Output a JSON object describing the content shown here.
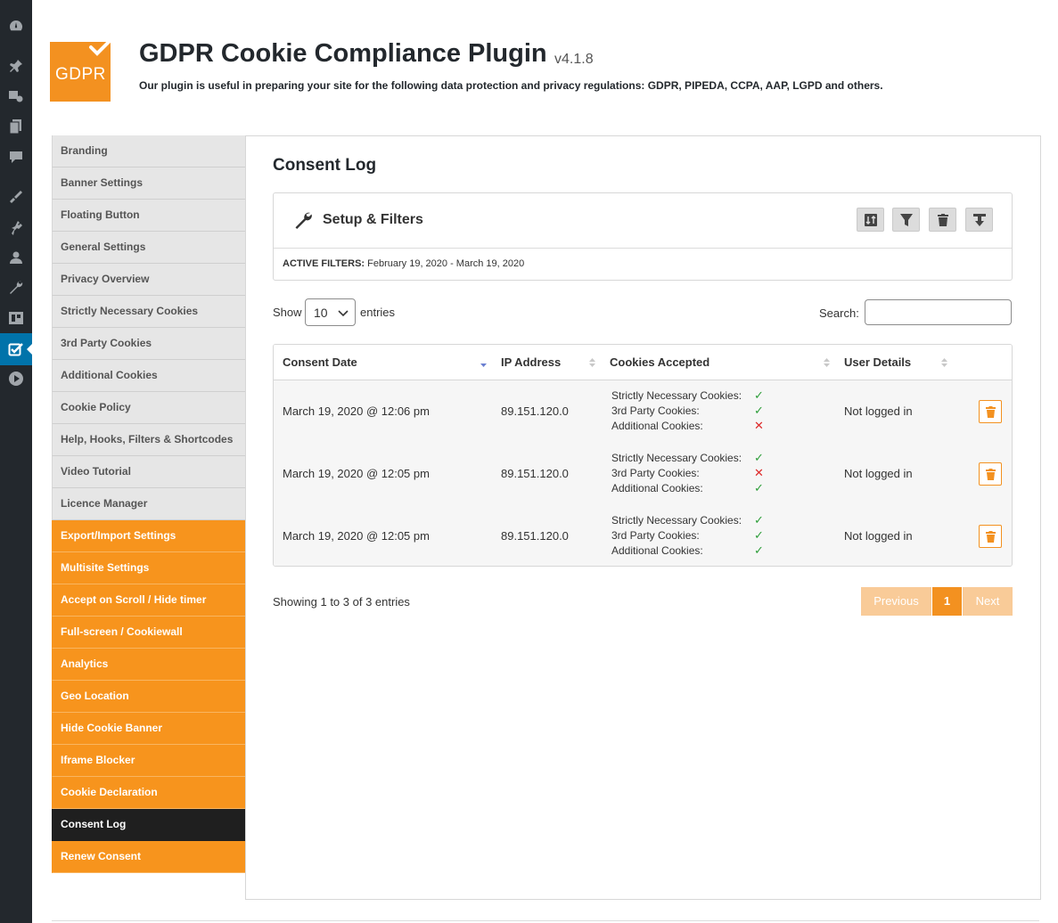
{
  "plugin": {
    "logo_text": "GDPR",
    "title": "GDPR Cookie Compliance Plugin",
    "version": "v4.1.8",
    "subtitle": "Our plugin is useful in preparing your site for the following data protection and privacy regulations: GDPR, PIPEDA, CCPA, AAP, LGPD and others."
  },
  "wp_menu": {
    "icons": [
      "dashboard-icon",
      "pin-icon",
      "media-icon",
      "pages-icon",
      "comments-icon",
      "appearance-icon",
      "plugins-icon",
      "users-icon",
      "tools-icon",
      "settings-icon",
      "gdpr-icon",
      "video-icon"
    ],
    "active_color": "#0073aa"
  },
  "nav": {
    "items": [
      {
        "label": "Branding",
        "style": "grey"
      },
      {
        "label": "Banner Settings",
        "style": "grey"
      },
      {
        "label": "Floating Button",
        "style": "grey"
      },
      {
        "label": "General Settings",
        "style": "grey"
      },
      {
        "label": "Privacy Overview",
        "style": "grey"
      },
      {
        "label": "Strictly Necessary Cookies",
        "style": "grey"
      },
      {
        "label": "3rd Party Cookies",
        "style": "grey"
      },
      {
        "label": "Additional Cookies",
        "style": "grey"
      },
      {
        "label": "Cookie Policy",
        "style": "grey"
      },
      {
        "label": "Help, Hooks, Filters & Shortcodes",
        "style": "grey"
      },
      {
        "label": "Video Tutorial",
        "style": "grey"
      },
      {
        "label": "Licence Manager",
        "style": "grey"
      },
      {
        "label": "Export/Import Settings",
        "style": "orange"
      },
      {
        "label": "Multisite Settings",
        "style": "orange"
      },
      {
        "label": "Accept on Scroll / Hide timer",
        "style": "orange"
      },
      {
        "label": "Full-screen / Cookiewall",
        "style": "orange"
      },
      {
        "label": "Analytics",
        "style": "orange"
      },
      {
        "label": "Geo Location",
        "style": "orange"
      },
      {
        "label": "Hide Cookie Banner",
        "style": "orange"
      },
      {
        "label": "Iframe Blocker",
        "style": "orange"
      },
      {
        "label": "Cookie Declaration",
        "style": "orange"
      },
      {
        "label": "Consent Log",
        "style": "active"
      },
      {
        "label": "Renew Consent",
        "style": "orange"
      }
    ]
  },
  "main": {
    "title": "Consent Log",
    "filters": {
      "title": "Setup & Filters",
      "buttons": [
        "sort-icon",
        "filter-icon",
        "trash-icon",
        "download-icon"
      ],
      "active_label": "ACTIVE FILTERS:",
      "active_value": "February 19, 2020 - March 19, 2020"
    },
    "show_label": "Show",
    "entries_value": "10",
    "entries_label": "entries",
    "search_label": "Search:",
    "search_value": "",
    "table": {
      "headers": [
        "Consent Date",
        "IP Address",
        "Cookies Accepted",
        "User Details"
      ],
      "rows": [
        {
          "date": "March 19, 2020 @ 12:06 pm",
          "ip": "89.151.120.0",
          "cookies": [
            {
              "label": "Strictly Necessary Cookies:",
              "mark": "✓",
              "ok": true
            },
            {
              "label": "3rd Party Cookies:",
              "mark": "✓",
              "ok": true
            },
            {
              "label": "Additional Cookies:",
              "mark": "✕",
              "ok": false
            }
          ],
          "user": "Not logged in"
        },
        {
          "date": "March 19, 2020 @ 12:05 pm",
          "ip": "89.151.120.0",
          "cookies": [
            {
              "label": "Strictly Necessary Cookies:",
              "mark": "✓",
              "ok": true
            },
            {
              "label": "3rd Party Cookies:",
              "mark": "✕",
              "ok": false
            },
            {
              "label": "Additional Cookies:",
              "mark": "✓",
              "ok": true
            }
          ],
          "user": "Not logged in"
        },
        {
          "date": "March 19, 2020 @ 12:05 pm",
          "ip": "89.151.120.0",
          "cookies": [
            {
              "label": "Strictly Necessary Cookies:",
              "mark": "✓",
              "ok": true
            },
            {
              "label": "3rd Party Cookies:",
              "mark": "✓",
              "ok": true
            },
            {
              "label": "Additional Cookies:",
              "mark": "✓",
              "ok": true
            }
          ],
          "user": "Not logged in"
        }
      ]
    },
    "showing": "Showing 1 to 3 of 3 entries",
    "pager": {
      "previous": "Previous",
      "current": "1",
      "next": "Next"
    }
  },
  "colors": {
    "accent": "#f39120",
    "accent_light": "#f9cb98",
    "active_nav": "#1f1f1f"
  }
}
